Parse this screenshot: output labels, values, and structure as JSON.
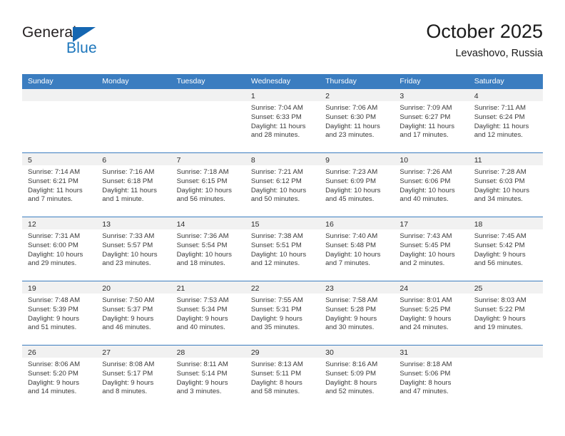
{
  "brand": {
    "name_part1": "General",
    "name_part2": "Blue"
  },
  "header": {
    "title": "October 2025",
    "subtitle": "Levashovo, Russia"
  },
  "colors": {
    "header_blue": "#3b7dc0",
    "brand_blue": "#1b75bb",
    "day_band_gray": "#f1f1f1",
    "text": "#3a3a3a"
  },
  "weekdays": [
    "Sunday",
    "Monday",
    "Tuesday",
    "Wednesday",
    "Thursday",
    "Friday",
    "Saturday"
  ],
  "weeks": [
    [
      {
        "day": "",
        "sunrise": "",
        "sunset": "",
        "daylight1": "",
        "daylight2": ""
      },
      {
        "day": "",
        "sunrise": "",
        "sunset": "",
        "daylight1": "",
        "daylight2": ""
      },
      {
        "day": "",
        "sunrise": "",
        "sunset": "",
        "daylight1": "",
        "daylight2": ""
      },
      {
        "day": "1",
        "sunrise": "Sunrise: 7:04 AM",
        "sunset": "Sunset: 6:33 PM",
        "daylight1": "Daylight: 11 hours",
        "daylight2": "and 28 minutes."
      },
      {
        "day": "2",
        "sunrise": "Sunrise: 7:06 AM",
        "sunset": "Sunset: 6:30 PM",
        "daylight1": "Daylight: 11 hours",
        "daylight2": "and 23 minutes."
      },
      {
        "day": "3",
        "sunrise": "Sunrise: 7:09 AM",
        "sunset": "Sunset: 6:27 PM",
        "daylight1": "Daylight: 11 hours",
        "daylight2": "and 17 minutes."
      },
      {
        "day": "4",
        "sunrise": "Sunrise: 7:11 AM",
        "sunset": "Sunset: 6:24 PM",
        "daylight1": "Daylight: 11 hours",
        "daylight2": "and 12 minutes."
      }
    ],
    [
      {
        "day": "5",
        "sunrise": "Sunrise: 7:14 AM",
        "sunset": "Sunset: 6:21 PM",
        "daylight1": "Daylight: 11 hours",
        "daylight2": "and 7 minutes."
      },
      {
        "day": "6",
        "sunrise": "Sunrise: 7:16 AM",
        "sunset": "Sunset: 6:18 PM",
        "daylight1": "Daylight: 11 hours",
        "daylight2": "and 1 minute."
      },
      {
        "day": "7",
        "sunrise": "Sunrise: 7:18 AM",
        "sunset": "Sunset: 6:15 PM",
        "daylight1": "Daylight: 10 hours",
        "daylight2": "and 56 minutes."
      },
      {
        "day": "8",
        "sunrise": "Sunrise: 7:21 AM",
        "sunset": "Sunset: 6:12 PM",
        "daylight1": "Daylight: 10 hours",
        "daylight2": "and 50 minutes."
      },
      {
        "day": "9",
        "sunrise": "Sunrise: 7:23 AM",
        "sunset": "Sunset: 6:09 PM",
        "daylight1": "Daylight: 10 hours",
        "daylight2": "and 45 minutes."
      },
      {
        "day": "10",
        "sunrise": "Sunrise: 7:26 AM",
        "sunset": "Sunset: 6:06 PM",
        "daylight1": "Daylight: 10 hours",
        "daylight2": "and 40 minutes."
      },
      {
        "day": "11",
        "sunrise": "Sunrise: 7:28 AM",
        "sunset": "Sunset: 6:03 PM",
        "daylight1": "Daylight: 10 hours",
        "daylight2": "and 34 minutes."
      }
    ],
    [
      {
        "day": "12",
        "sunrise": "Sunrise: 7:31 AM",
        "sunset": "Sunset: 6:00 PM",
        "daylight1": "Daylight: 10 hours",
        "daylight2": "and 29 minutes."
      },
      {
        "day": "13",
        "sunrise": "Sunrise: 7:33 AM",
        "sunset": "Sunset: 5:57 PM",
        "daylight1": "Daylight: 10 hours",
        "daylight2": "and 23 minutes."
      },
      {
        "day": "14",
        "sunrise": "Sunrise: 7:36 AM",
        "sunset": "Sunset: 5:54 PM",
        "daylight1": "Daylight: 10 hours",
        "daylight2": "and 18 minutes."
      },
      {
        "day": "15",
        "sunrise": "Sunrise: 7:38 AM",
        "sunset": "Sunset: 5:51 PM",
        "daylight1": "Daylight: 10 hours",
        "daylight2": "and 12 minutes."
      },
      {
        "day": "16",
        "sunrise": "Sunrise: 7:40 AM",
        "sunset": "Sunset: 5:48 PM",
        "daylight1": "Daylight: 10 hours",
        "daylight2": "and 7 minutes."
      },
      {
        "day": "17",
        "sunrise": "Sunrise: 7:43 AM",
        "sunset": "Sunset: 5:45 PM",
        "daylight1": "Daylight: 10 hours",
        "daylight2": "and 2 minutes."
      },
      {
        "day": "18",
        "sunrise": "Sunrise: 7:45 AM",
        "sunset": "Sunset: 5:42 PM",
        "daylight1": "Daylight: 9 hours",
        "daylight2": "and 56 minutes."
      }
    ],
    [
      {
        "day": "19",
        "sunrise": "Sunrise: 7:48 AM",
        "sunset": "Sunset: 5:39 PM",
        "daylight1": "Daylight: 9 hours",
        "daylight2": "and 51 minutes."
      },
      {
        "day": "20",
        "sunrise": "Sunrise: 7:50 AM",
        "sunset": "Sunset: 5:37 PM",
        "daylight1": "Daylight: 9 hours",
        "daylight2": "and 46 minutes."
      },
      {
        "day": "21",
        "sunrise": "Sunrise: 7:53 AM",
        "sunset": "Sunset: 5:34 PM",
        "daylight1": "Daylight: 9 hours",
        "daylight2": "and 40 minutes."
      },
      {
        "day": "22",
        "sunrise": "Sunrise: 7:55 AM",
        "sunset": "Sunset: 5:31 PM",
        "daylight1": "Daylight: 9 hours",
        "daylight2": "and 35 minutes."
      },
      {
        "day": "23",
        "sunrise": "Sunrise: 7:58 AM",
        "sunset": "Sunset: 5:28 PM",
        "daylight1": "Daylight: 9 hours",
        "daylight2": "and 30 minutes."
      },
      {
        "day": "24",
        "sunrise": "Sunrise: 8:01 AM",
        "sunset": "Sunset: 5:25 PM",
        "daylight1": "Daylight: 9 hours",
        "daylight2": "and 24 minutes."
      },
      {
        "day": "25",
        "sunrise": "Sunrise: 8:03 AM",
        "sunset": "Sunset: 5:22 PM",
        "daylight1": "Daylight: 9 hours",
        "daylight2": "and 19 minutes."
      }
    ],
    [
      {
        "day": "26",
        "sunrise": "Sunrise: 8:06 AM",
        "sunset": "Sunset: 5:20 PM",
        "daylight1": "Daylight: 9 hours",
        "daylight2": "and 14 minutes."
      },
      {
        "day": "27",
        "sunrise": "Sunrise: 8:08 AM",
        "sunset": "Sunset: 5:17 PM",
        "daylight1": "Daylight: 9 hours",
        "daylight2": "and 8 minutes."
      },
      {
        "day": "28",
        "sunrise": "Sunrise: 8:11 AM",
        "sunset": "Sunset: 5:14 PM",
        "daylight1": "Daylight: 9 hours",
        "daylight2": "and 3 minutes."
      },
      {
        "day": "29",
        "sunrise": "Sunrise: 8:13 AM",
        "sunset": "Sunset: 5:11 PM",
        "daylight1": "Daylight: 8 hours",
        "daylight2": "and 58 minutes."
      },
      {
        "day": "30",
        "sunrise": "Sunrise: 8:16 AM",
        "sunset": "Sunset: 5:09 PM",
        "daylight1": "Daylight: 8 hours",
        "daylight2": "and 52 minutes."
      },
      {
        "day": "31",
        "sunrise": "Sunrise: 8:18 AM",
        "sunset": "Sunset: 5:06 PM",
        "daylight1": "Daylight: 8 hours",
        "daylight2": "and 47 minutes."
      },
      {
        "day": "",
        "sunrise": "",
        "sunset": "",
        "daylight1": "",
        "daylight2": ""
      }
    ]
  ]
}
